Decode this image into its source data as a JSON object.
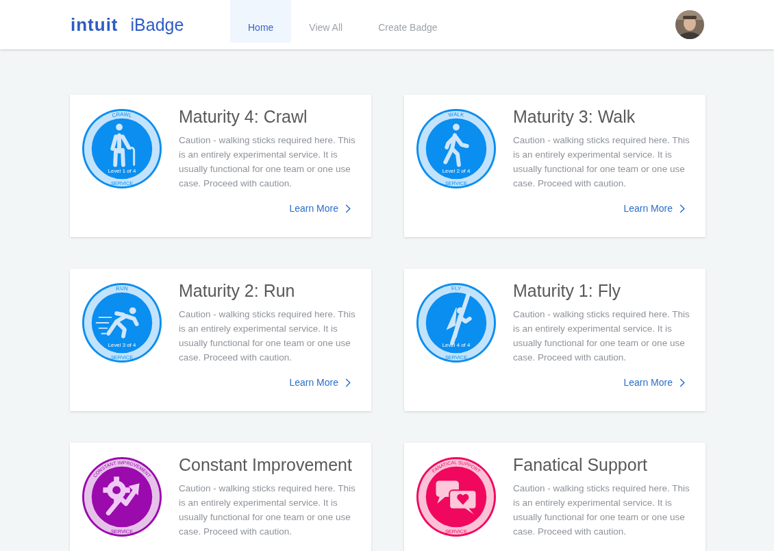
{
  "header": {
    "logo": "intuit",
    "app_name": "iBadge",
    "nav": [
      {
        "label": "Home",
        "selected": true
      },
      {
        "label": "View All",
        "selected": false
      },
      {
        "label": "Create Badge",
        "selected": false
      }
    ]
  },
  "cards": [
    {
      "title": "Maturity 4: Crawl",
      "description": "Caution - walking sticks required here. This is an entirely experimental service. It is usually functional for one team or one use case. Proceed with caution.",
      "link": "Learn More",
      "badge": {
        "kind": "crawl",
        "color": "#0a8ef0",
        "top_text": "CRAWL",
        "level_text": "Level 1 of 4",
        "bottom_text": "SERVICE"
      }
    },
    {
      "title": "Maturity 3: Walk",
      "description": "Caution - walking sticks required here. This is an entirely experimental service. It is usually functional for one team or one use case. Proceed with caution.",
      "link": "Learn More",
      "badge": {
        "kind": "walk",
        "color": "#0a8ef0",
        "top_text": "WALK",
        "level_text": "Level 2 of 4",
        "bottom_text": "SERVICE"
      }
    },
    {
      "title": "Maturity 2: Run",
      "description": "Caution - walking sticks required here. This is an entirely experimental service. It is usually functional for one team or one use case. Proceed with caution.",
      "link": "Learn More",
      "badge": {
        "kind": "run",
        "color": "#0a8ef0",
        "top_text": "RUN",
        "level_text": "Level 3 of 4",
        "bottom_text": "SERVICE"
      }
    },
    {
      "title": "Maturity 1: Fly",
      "description": "Caution - walking sticks required here. This is an entirely experimental service. It is usually functional for one team or one use case. Proceed with caution.",
      "link": "Learn More",
      "badge": {
        "kind": "fly",
        "color": "#0a8ef0",
        "top_text": "FLY",
        "level_text": "Level 4 of 4",
        "bottom_text": "SERVICE"
      }
    },
    {
      "title": "Constant Improvement",
      "description": "Caution - walking sticks required here. This is an entirely experimental service. It is usually functional for one team or one use case. Proceed with caution.",
      "badge": {
        "kind": "improve",
        "color": "#9a0aac",
        "top_text": "CONSTANT IMPROVEMENT",
        "bottom_text": "SERVICE"
      }
    },
    {
      "title": "Fanatical Support",
      "description": "Caution - walking sticks required here. This is an entirely experimental service. It is usually functional for one team or one use case. Proceed with caution.",
      "badge": {
        "kind": "support",
        "color": "#f0085e",
        "top_text": "FANATICAL SUPPORT",
        "bottom_text": "SERVICE"
      }
    }
  ]
}
